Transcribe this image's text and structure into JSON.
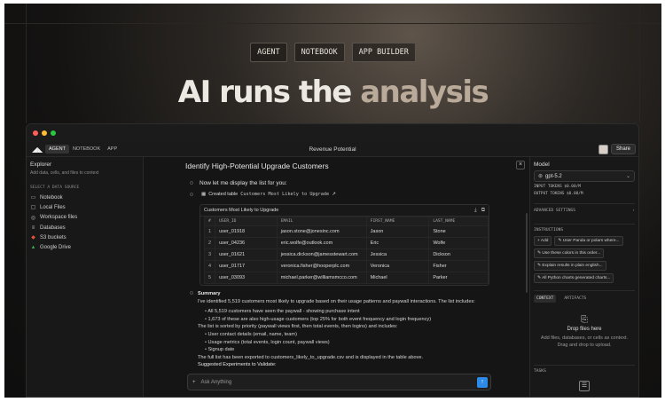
{
  "hero": {
    "tabs": [
      "AGENT",
      "NOTEBOOK",
      "APP BUILDER"
    ],
    "headline_main": "AI runs the ",
    "headline_accent": "analysis"
  },
  "app": {
    "top_tabs": [
      "AGENT",
      "NOTEBOOK",
      "APP"
    ],
    "doc_title": "Revenue Potential",
    "share_label": "Share"
  },
  "explorer": {
    "title": "Explorer",
    "subtitle": "Add data, cells, and files to context",
    "section": "SELECT A DATA SOURCE",
    "items": [
      {
        "label": "Notebook",
        "icon": "notebook-icon",
        "glyph": "▭"
      },
      {
        "label": "Local Files",
        "icon": "monitor-icon",
        "glyph": "▢"
      },
      {
        "label": "Workspace files",
        "icon": "workspace-icon",
        "glyph": "◎"
      },
      {
        "label": "Databases",
        "icon": "database-icon",
        "glyph": "≡"
      },
      {
        "label": "S3 buckets",
        "icon": "s3-bucket-icon",
        "glyph": "◆"
      },
      {
        "label": "Google Drive",
        "icon": "google-drive-icon",
        "glyph": "▲"
      }
    ]
  },
  "chat": {
    "title": "Identify High-Potential Upgrade Customers",
    "message": "Now let me display the list for you:",
    "created_label": "Created table",
    "created_name": "Customers Most Likely to Upgrade",
    "table_title": "Customers Most Likely to Upgrade",
    "columns": [
      "#",
      "USER_ID",
      "EMAIL",
      "FIRST_NAME",
      "LAST_NAME"
    ],
    "rows": [
      [
        "1",
        "user_01918",
        "jason.stone@jonesinc.com",
        "Jason",
        "Stone"
      ],
      [
        "2",
        "user_04236",
        "eric.wolfe@outlook.com",
        "Eric",
        "Wolfe"
      ],
      [
        "3",
        "user_01621",
        "jessica.dickson@jamesstewart.com",
        "Jessica",
        "Dickson"
      ],
      [
        "4",
        "user_01717",
        "veronica.fisher@hooperplc.com",
        "Veronica",
        "Fisher"
      ],
      [
        "5",
        "user_03093",
        "michael.parker@williamsmcco.com",
        "Michael",
        "Parker"
      ]
    ],
    "summary_heading": "Summary",
    "summary_intro": "I've identified 5,519 customers most likely to upgrade based on their usage patterns and paywall interactions. The list includes:",
    "summary_points_1": [
      "All 5,519 customers have seen the paywall - showing purchase intent",
      "1,673 of these are also high-usage customers (top 25% for both event frequency and login frequency)"
    ],
    "summary_sorted": "The list is sorted by priority (paywall views first, then total events, then logins) and includes:",
    "summary_points_2": [
      "User contact details (email, name, team)",
      "Usage metrics (total events, login count, paywall views)",
      "Signup date"
    ],
    "summary_export": "The full list has been exported to customers_likely_to_upgrade.csv and is displayed in the table above.",
    "summary_next": "Suggested Experiments to Validate:",
    "ask_placeholder": "Ask Anything"
  },
  "side": {
    "model_label": "Model",
    "model_value": "gpt-5.2",
    "input_tokens": "INPUT TOKENS  $0.00/M",
    "output_tokens": "OUTPUT TOKENS  $0.00/M",
    "advanced": "ADVANCED SETTINGS",
    "instructions": "INSTRUCTIONS",
    "chips": [
      "Add",
      "User Panda or polars where...",
      "Use these colors in this order...",
      "Explain results in plain english...",
      "All Python charts generated charts..."
    ],
    "context_tab": "CONTEXT",
    "artifacts_tab": "ARTIFACTS",
    "drop_title": "Drop files here",
    "drop_sub": "Add files, databases, or cells as context.",
    "drop_sub2": "Drag and drop to upload.",
    "tasks": "TASKS"
  },
  "colors": {
    "accent_send": "#2d8ae6",
    "headline_accent": "#b9aa99"
  }
}
